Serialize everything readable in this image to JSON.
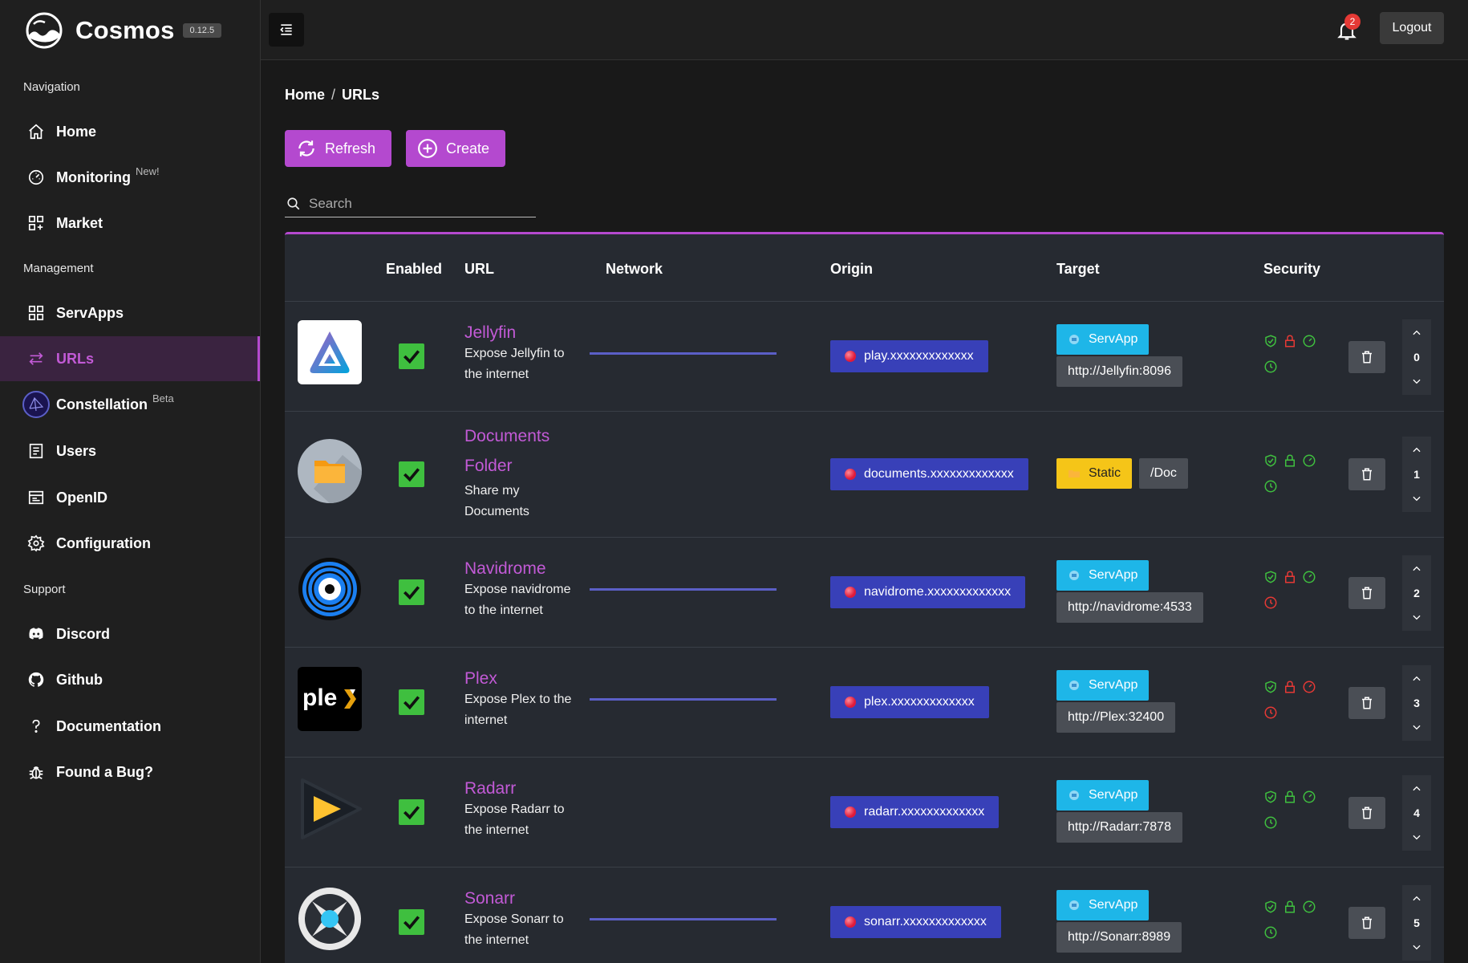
{
  "app": {
    "name": "Cosmos",
    "version": "0.12.5"
  },
  "sidebar": {
    "sections": {
      "navigation": "Navigation",
      "management": "Management",
      "support": "Support"
    },
    "items": [
      {
        "label": "Home",
        "icon": "home-icon"
      },
      {
        "label": "Monitoring",
        "badge": "New!",
        "icon": "gauge-icon"
      },
      {
        "label": "Market",
        "icon": "market-icon"
      },
      {
        "label": "ServApps",
        "icon": "grid-icon"
      },
      {
        "label": "URLs",
        "icon": "arrows-icon",
        "active": true
      },
      {
        "label": "Constellation",
        "badge": "Beta",
        "icon": "constellation-icon"
      },
      {
        "label": "Users",
        "icon": "users-icon"
      },
      {
        "label": "OpenID",
        "icon": "openid-icon"
      },
      {
        "label": "Configuration",
        "icon": "gear-icon"
      },
      {
        "label": "Discord",
        "icon": "discord-icon"
      },
      {
        "label": "Github",
        "icon": "github-icon"
      },
      {
        "label": "Documentation",
        "icon": "question-icon"
      },
      {
        "label": "Found a Bug?",
        "icon": "bug-icon"
      }
    ]
  },
  "topbar": {
    "notifications_count": "2",
    "logout_label": "Logout"
  },
  "breadcrumb": {
    "home": "Home",
    "separator": "/",
    "current": "URLs"
  },
  "toolbar": {
    "refresh_label": "Refresh",
    "create_label": "Create"
  },
  "search": {
    "placeholder": "Search",
    "value": ""
  },
  "table": {
    "headers": {
      "enabled": "Enabled",
      "url": "URL",
      "network": "Network",
      "origin": "Origin",
      "target": "Target",
      "security": "Security"
    },
    "rows": [
      {
        "name": "Jellyfin",
        "description": "Expose Jellyfin to the internet",
        "origin": "play.xxxxxxxxxxxxx",
        "target_type": "ServApp",
        "target": "http://Jellyfin:8096",
        "order": "0",
        "network": true,
        "security": {
          "shield": "green",
          "lock": "red",
          "gauge": "green",
          "clock": "green"
        }
      },
      {
        "name": "Documents Folder",
        "description": "Share my Documents",
        "origin": "documents.xxxxxxxxxxxxx",
        "target_type": "Static",
        "target": "/Doc",
        "order": "1",
        "network": false,
        "security": {
          "shield": "green",
          "lock": "green",
          "gauge": "green",
          "clock": "green"
        }
      },
      {
        "name": "Navidrome",
        "description": "Expose navidrome to the internet",
        "origin": "navidrome.xxxxxxxxxxxxx",
        "target_type": "ServApp",
        "target": "http://navidrome:4533",
        "order": "2",
        "network": true,
        "security": {
          "shield": "green",
          "lock": "red",
          "gauge": "green",
          "clock": "red"
        }
      },
      {
        "name": "Plex",
        "description": "Expose Plex to the internet",
        "origin": "plex.xxxxxxxxxxxxx",
        "target_type": "ServApp",
        "target": "http://Plex:32400",
        "order": "3",
        "network": true,
        "security": {
          "shield": "green",
          "lock": "red",
          "gauge": "red",
          "clock": "red"
        }
      },
      {
        "name": "Radarr",
        "description": "Expose Radarr to the internet",
        "origin": "radarr.xxxxxxxxxxxxx",
        "target_type": "ServApp",
        "target": "http://Radarr:7878",
        "order": "4",
        "network": false,
        "security": {
          "shield": "green",
          "lock": "green",
          "gauge": "green",
          "clock": "green"
        }
      },
      {
        "name": "Sonarr",
        "description": "Expose Sonarr to the internet",
        "origin": "sonarr.xxxxxxxxxxxxx",
        "target_type": "ServApp",
        "target": "http://Sonarr:8989",
        "order": "5",
        "network": true,
        "security": {
          "shield": "green",
          "lock": "green",
          "gauge": "green",
          "clock": "green"
        }
      }
    ]
  },
  "colors": {
    "accent": "#b449cf",
    "origin": "#3840b8",
    "servapp": "#1eb6e8",
    "static": "#f5c518",
    "ok": "#3fbf3f",
    "danger": "#e53935"
  }
}
